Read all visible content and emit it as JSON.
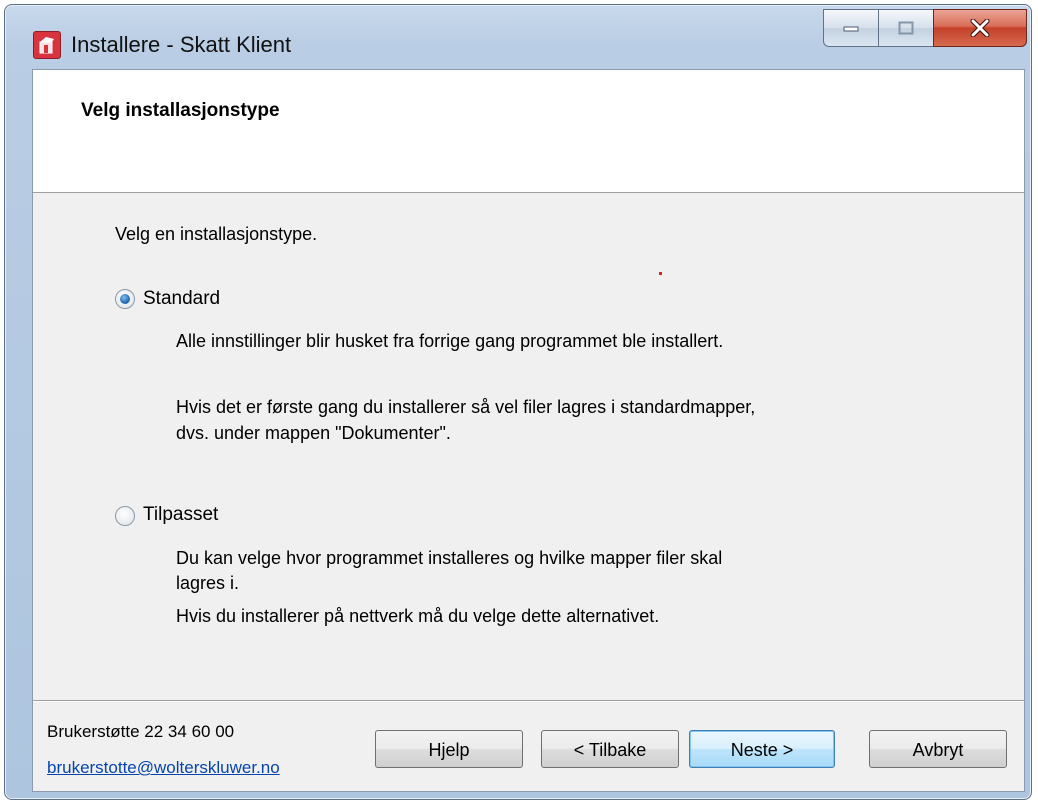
{
  "window": {
    "title": "Installere - Skatt Klient",
    "app_icon": "package-icon",
    "controls": [
      "minimize-icon",
      "maximize-icon",
      "close-icon"
    ]
  },
  "header": {
    "title": "Velg installasjonstype"
  },
  "main": {
    "prompt": "Velg en installasjonstype.",
    "options": [
      {
        "label": "Standard",
        "checked": true,
        "descriptions": [
          "Alle innstillinger blir husket fra forrige gang programmet ble installert.",
          "Hvis det er første gang du installerer så vel filer lagres i standardmapper,",
          "dvs. under mappen \"Dokumenter\"."
        ]
      },
      {
        "label": "Tilpasset",
        "checked": false,
        "descriptions": [
          "Du kan velge hvor programmet installeres og hvilke mapper filer skal",
          "lagres i.",
          "Hvis du installerer på nettverk må du velge dette alternativet."
        ]
      }
    ]
  },
  "footer": {
    "support_text": "Brukerstøtte 22 34 60 00",
    "support_email": "brukerstotte@wolterskluwer.no",
    "buttons": {
      "help": "Hjelp",
      "back": "< Tilbake",
      "next": "Neste >",
      "cancel": "Avbryt"
    }
  },
  "colors": {
    "accent": "#3c7fb1",
    "link": "#0645ad",
    "icon_red": "#d8343f"
  }
}
